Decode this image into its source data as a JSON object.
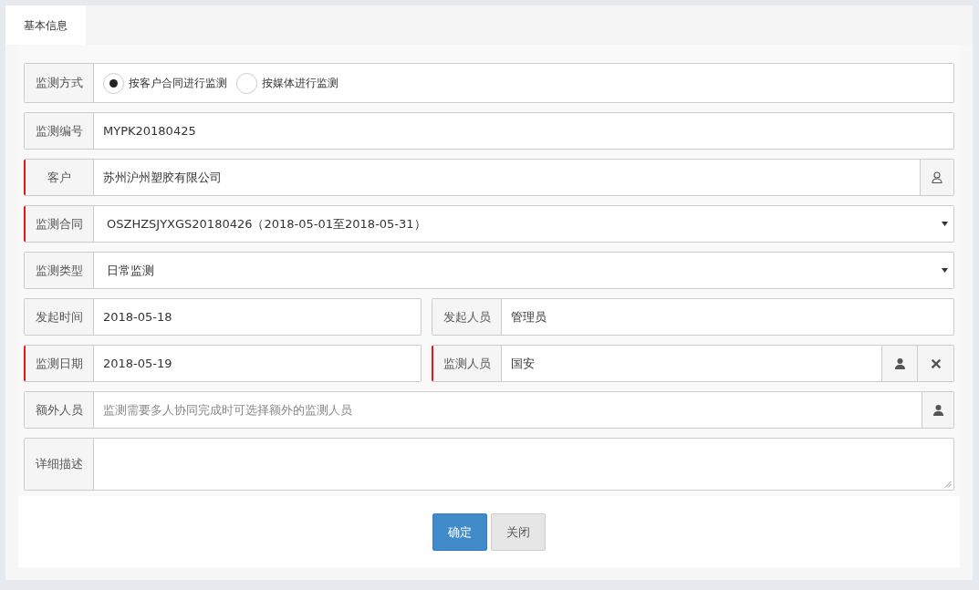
{
  "tabs": [
    {
      "label": "基本信息",
      "selected": true
    }
  ],
  "rows": [
    {
      "kind": "radio",
      "label": "监测方式",
      "required": false,
      "options": [
        {
          "label": "按客户合同进行监测",
          "selected": true
        },
        {
          "label": "按媒体进行监测",
          "selected": false
        }
      ]
    },
    {
      "kind": "text",
      "label": "监测编号",
      "required": false,
      "value": "MYPK20180425"
    },
    {
      "kind": "picker",
      "label": "客户",
      "required": true,
      "value": "苏州沪州塑胶有限公司"
    },
    {
      "kind": "select",
      "label": "监测合同",
      "required": true,
      "value": "OSZHZSJYXGS20180426（2018-05-01至2018-05-31）"
    },
    {
      "kind": "select",
      "label": "监测类型",
      "required": false,
      "value": "日常监测"
    },
    {
      "kind": "pair",
      "fields": [
        {
          "kind": "text",
          "label": "发起时间",
          "required": false,
          "value": "2018-05-18"
        },
        {
          "kind": "text",
          "label": "发起人员",
          "required": false,
          "value": "管理员"
        }
      ]
    },
    {
      "kind": "pair",
      "fields": [
        {
          "kind": "text",
          "label": "监测日期",
          "required": true,
          "value": "2018-05-19"
        },
        {
          "kind": "person",
          "label": "监测人员",
          "required": true,
          "value": "国安"
        }
      ]
    },
    {
      "kind": "multi-person",
      "label": "额外人员",
      "required": false,
      "placeholder": "监测需要多人协同完成时可选择额外的监测人员"
    },
    {
      "kind": "textarea",
      "label": "详细描述",
      "required": false
    }
  ],
  "buttons": [
    {
      "label": "确定",
      "kind": "primary"
    },
    {
      "label": "关闭",
      "kind": "default"
    }
  ]
}
